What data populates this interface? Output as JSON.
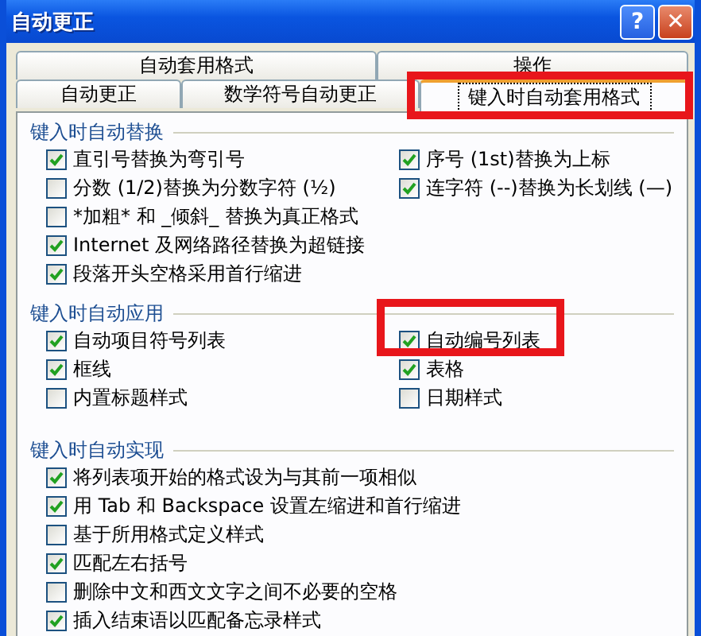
{
  "window": {
    "title": "自动更正",
    "buttons": [
      {
        "kind": "help",
        "label": "?"
      },
      {
        "kind": "close",
        "label": "✕"
      }
    ]
  },
  "tab_rows": [
    [
      {
        "label": "自动套用格式",
        "selected": false
      },
      {
        "label": "操作",
        "selected": false
      }
    ],
    [
      {
        "label": "自动更正",
        "selected": false
      },
      {
        "label": "数学符号自动更正",
        "selected": false
      },
      {
        "label": "键入时自动套用格式",
        "selected": true
      }
    ]
  ],
  "groups": [
    {
      "title": "键入时自动替换",
      "columns": [
        [
          {
            "label": "直引号替换为弯引号",
            "checked": true
          },
          {
            "label": "分数 (1/2)替换为分数字符 (½)",
            "checked": false
          },
          {
            "label": "*加粗* 和 _倾斜_ 替换为真正格式",
            "checked": false
          },
          {
            "label": "Internet 及网络路径替换为超链接",
            "checked": true
          },
          {
            "label": "段落开头空格采用首行缩进",
            "checked": true
          }
        ],
        [
          {
            "label": "序号 (1st)替换为上标",
            "checked": true
          },
          {
            "label": "连字符 (--)替换为长划线 (—)",
            "checked": true
          }
        ]
      ]
    },
    {
      "title": "键入时自动应用",
      "columns": [
        [
          {
            "label": "自动项目符号列表",
            "checked": true
          },
          {
            "label": "框线",
            "checked": true
          },
          {
            "label": "内置标题样式",
            "checked": false
          }
        ],
        [
          {
            "label": "自动编号列表",
            "checked": true
          },
          {
            "label": "表格",
            "checked": true
          },
          {
            "label": "日期样式",
            "checked": false
          }
        ]
      ]
    },
    {
      "title": "键入时自动实现",
      "columns": [
        [
          {
            "label": "将列表项开始的格式设为与其前一项相似",
            "checked": true
          },
          {
            "label": "用 Tab 和 Backspace 设置左缩进和首行缩进",
            "checked": true
          },
          {
            "label": "基于所用格式定义样式",
            "checked": false
          },
          {
            "label": "匹配左右括号",
            "checked": true
          },
          {
            "label": "删除中文和西文文字之间不必要的空格",
            "checked": false
          },
          {
            "label": "插入结束语以匹配备忘录样式",
            "checked": true
          }
        ]
      ]
    }
  ]
}
